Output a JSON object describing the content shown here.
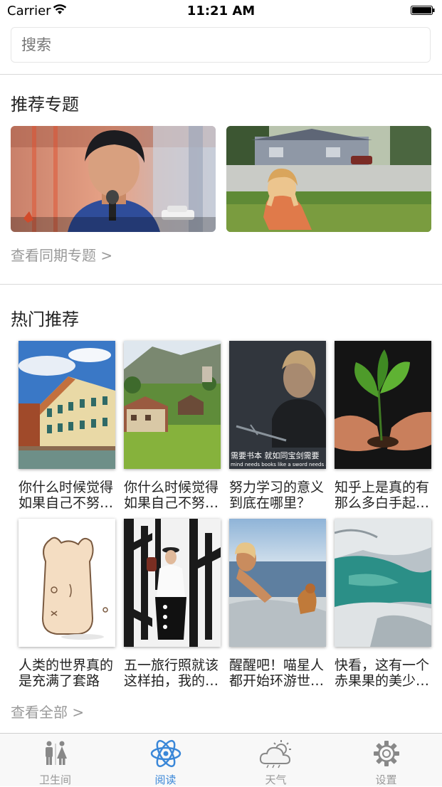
{
  "status_bar": {
    "carrier": "Carrier",
    "time": "11:21 AM"
  },
  "search": {
    "placeholder": "搜索"
  },
  "recommended": {
    "title": "推荐专题",
    "more_link": "查看同期专题 >"
  },
  "hot": {
    "title": "热门推荐",
    "items": [
      {
        "title": "你什么时候觉得如果自己不努…"
      },
      {
        "title": "你什么时候觉得如果自己不努…"
      },
      {
        "title": "努力学习的意义到底在哪里？",
        "caption_cn": "需要书本  就如同宝剑需要",
        "caption_en": "mind needs books like a sword needs a wh"
      },
      {
        "title": "知乎上是真的有那么多白手起…"
      },
      {
        "title": "人类的世界真的是充满了套路"
      },
      {
        "title": "五一旅行照就该这样拍，我的…"
      },
      {
        "title": "醒醒吧！喵星人都开始环游世…"
      },
      {
        "title": "快看，这有一个赤果果的美少…"
      }
    ],
    "more_link": "查看全部 >"
  },
  "tabbar": {
    "tabs": [
      {
        "label": "卫生间",
        "icon": "restroom-icon"
      },
      {
        "label": "阅读",
        "icon": "atom-icon"
      },
      {
        "label": "天气",
        "icon": "weather-icon"
      },
      {
        "label": "设置",
        "icon": "gear-icon"
      }
    ],
    "active_index": 1,
    "active_color": "#3a87d8",
    "inactive_color": "#999999"
  }
}
